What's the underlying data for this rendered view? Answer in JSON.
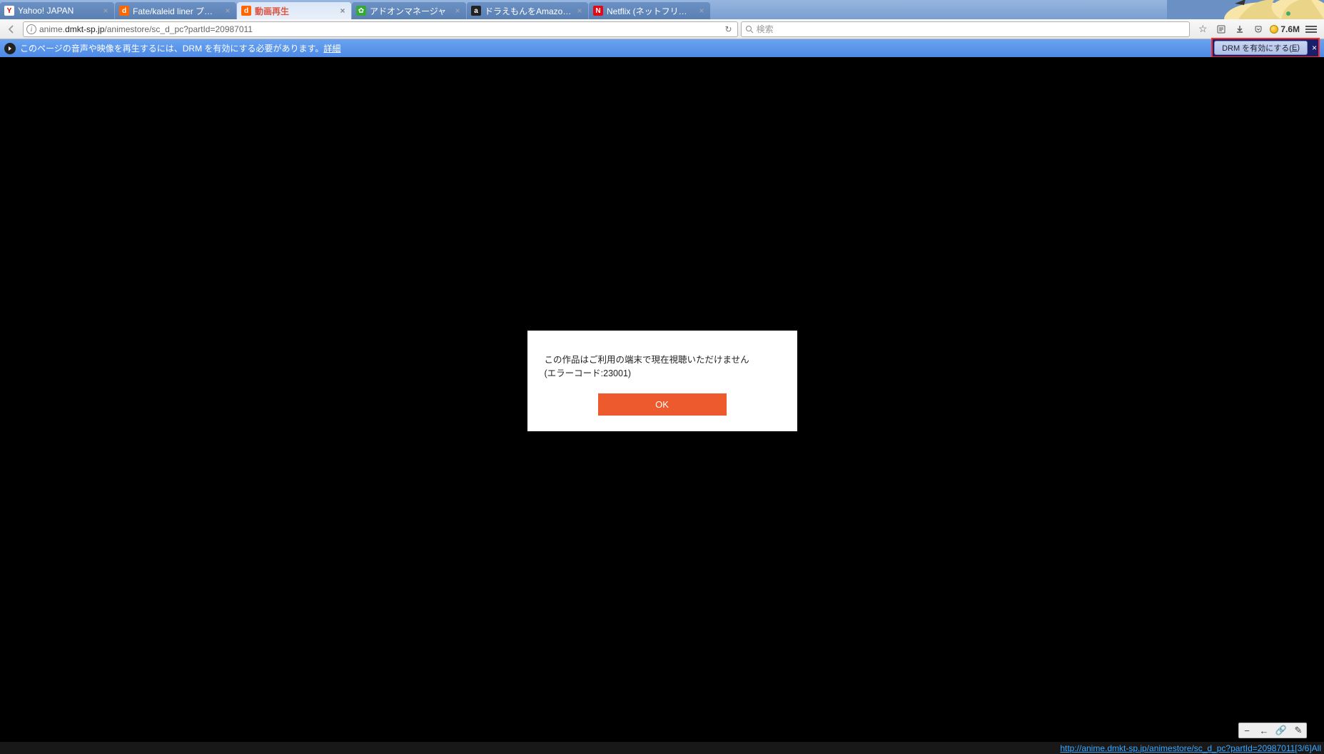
{
  "tabs": [
    {
      "title": "Yahoo! JAPAN",
      "favicon": "Y",
      "fvcls": "fv-y"
    },
    {
      "title": "Fate/kaleid liner プリ…",
      "favicon": "d",
      "fvcls": "fv-d"
    },
    {
      "title": "動画再生",
      "favicon": "d",
      "fvcls": "fv-d",
      "active": true
    },
    {
      "title": "アドオンマネージャ",
      "favicon": "✿",
      "fvcls": "fv-p"
    },
    {
      "title": "ドラえもんをAmazonビ…",
      "favicon": "a",
      "fvcls": "fv-a"
    },
    {
      "title": "Netflix (ネットフリックス)…",
      "favicon": "N",
      "fvcls": "fv-n"
    }
  ],
  "url": {
    "prefix": "anime.",
    "domain": "dmkt-sp.jp",
    "path": "/animestore/sc_d_pc?partId=20987011"
  },
  "search": {
    "placeholder": "検索"
  },
  "toolbar": {
    "memory": "7.6M"
  },
  "notification": {
    "text": "このページの音声や映像を再生するには、DRM を有効にする必要があります。",
    "detail": "詳細",
    "drm_button": "DRM を有効にする(",
    "drm_key": "E",
    "drm_button_suffix": ")"
  },
  "dialog": {
    "line1": "この作品はご利用の端末で現在視聴いただけません",
    "line2": "(エラーコード:23001)",
    "ok": "OK"
  },
  "minitb": {
    "minus": "−",
    "left": "←",
    "link": "🔗",
    "edit": "✎"
  },
  "status": {
    "url": "http://anime.dmkt-sp.jp/animestore/sc_d_pc?partId=20987011",
    "seg": " [3/6]",
    "all": "All"
  }
}
